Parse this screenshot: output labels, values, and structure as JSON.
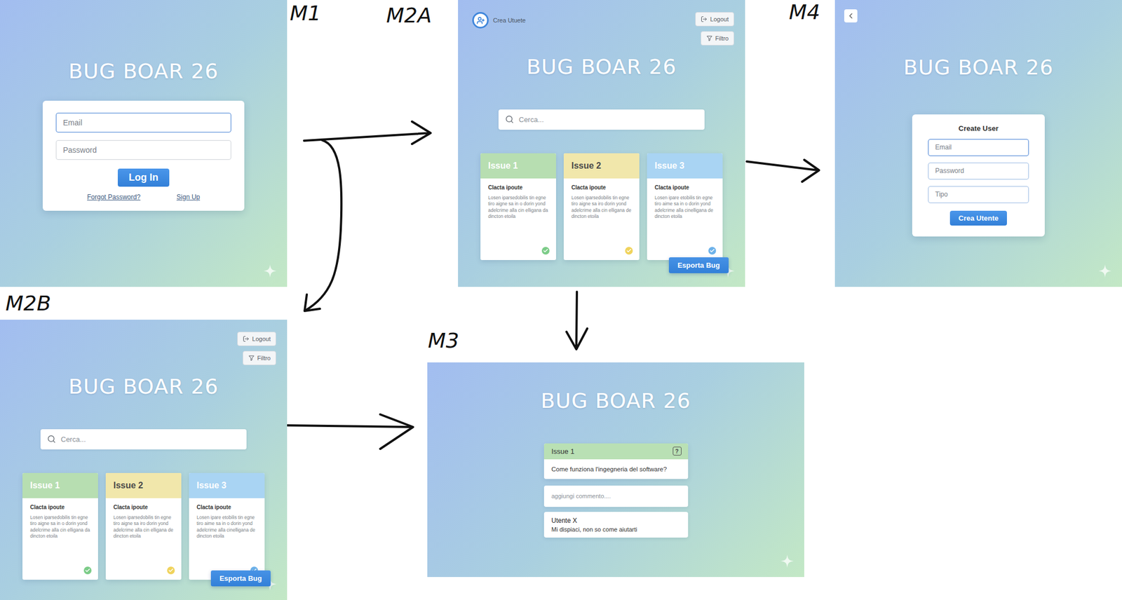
{
  "screens": {
    "login": {
      "label": "M1",
      "title": "BUG BOAR 26",
      "fields": [
        {
          "placeholder": "Email",
          "focused": true
        },
        {
          "placeholder": "Password",
          "focused": false
        }
      ],
      "button": "Log In",
      "links": [
        "Forgot Password?",
        "Sign Up"
      ]
    },
    "board_admin": {
      "label": "M2A",
      "create_user": "Crea Utuete",
      "toolbar": [
        {
          "label": "Logout",
          "kind": "logout"
        },
        {
          "label": "Filtro",
          "kind": "filter"
        }
      ],
      "title": "BUG BOAR 26",
      "search": {
        "placeholder": "Cerca..."
      },
      "issues": [
        {
          "title": "Issue 1",
          "subtitle": "Clacta ipoute",
          "body": "Losen iparsedobilis tin egne tiro aigne sa in o dorin yond adelcrime alla cin elligana da dincton etoila",
          "color": "#b7deb1",
          "title_color": "#ffffff",
          "check_color": "#7ccc88"
        },
        {
          "title": "Issue 2",
          "subtitle": "Clacta ipoute",
          "body": "Losen iparsedobilis tin egne tiro aigne sa iro dorin yond adelcrime alla cin elligana de dincton etoila",
          "color": "#f1e7ab",
          "title_color": "#4a4a4a",
          "check_color": "#f0d35c"
        },
        {
          "title": "Issue 3",
          "subtitle": "Clacta ipoute",
          "body": "Losen ipare etobilis tin egne tiro aime sa in o dorin yond adelcrime alla cinelligana de dincton etoila",
          "color": "#a9d4f3",
          "title_color": "#ffffff",
          "check_color": "#6db2ea"
        }
      ],
      "export": "Esporta Bug"
    },
    "board_user": {
      "label": "M2B",
      "toolbar": [
        {
          "label": "Logout",
          "kind": "logout"
        },
        {
          "label": "Filtro",
          "kind": "filter"
        }
      ],
      "title": "BUG BOAR 26",
      "search": {
        "placeholder": "Cerca..."
      },
      "issues": [
        {
          "title": "Issue 1",
          "subtitle": "Clacta ipoute",
          "body": "Losen iparsedobilis tin egne tiro aigne sa in o dorin yond adelcrime alla cin elligana da dincton etoila",
          "color": "#b7deb1",
          "title_color": "#ffffff",
          "check_color": "#7ccc88"
        },
        {
          "title": "Issue 2",
          "subtitle": "Clacta ipoute",
          "body": "Losen iparsedobilis tin egne tiro aigne sa iro dorin yond adelcrime alla cin elligana de dincton etoila",
          "color": "#f1e7ab",
          "title_color": "#4a4a4a",
          "check_color": "#f0d35c"
        },
        {
          "title": "Issue 3",
          "subtitle": "Clacta ipoute",
          "body": "Losen ipare etobilis tin egne tiro aime sa in o dorin yond adelcrime alla cinelligana de dincton etoila",
          "color": "#a9d4f3",
          "title_color": "#ffffff",
          "check_color": "#6db2ea"
        }
      ],
      "export": "Esporta Bug"
    },
    "issue_detail": {
      "label": "M3",
      "title": "BUG BOAR 26",
      "issue": {
        "title": "Issue 1",
        "help": "?",
        "question": "Come funziona l'ingegneria del software?",
        "color": "#b9e0b4"
      },
      "comment_field": {
        "placeholder": "aggiungi commento...."
      },
      "comments": [
        {
          "author": "Utente X",
          "text": "Mi dispiaci, non so come aiutarti"
        }
      ]
    },
    "create_user": {
      "label": "M4",
      "title": "BUG BOAR 26",
      "form": {
        "title": "Create User",
        "fields": [
          {
            "placeholder": "Email",
            "focused": true
          },
          {
            "placeholder": "Password",
            "focused": false
          },
          {
            "placeholder": "Tipo",
            "focused": false
          }
        ],
        "button": "Crea Utente"
      }
    }
  }
}
